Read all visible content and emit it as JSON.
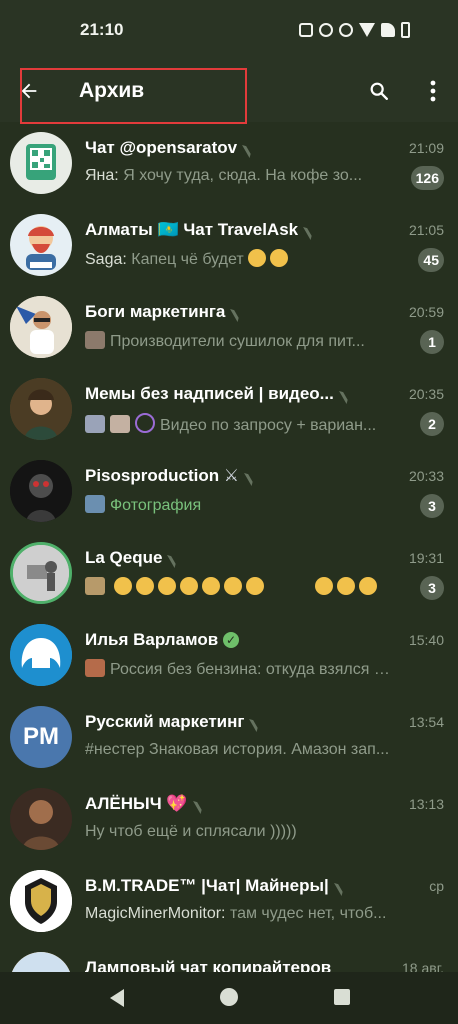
{
  "status": {
    "time": "21:10"
  },
  "header": {
    "title": "Архив"
  },
  "chats": [
    {
      "name": "Чат @opensaratov",
      "time": "21:09",
      "sender": "Яна:",
      "preview": "Я хочу туда, сюда. На кофе зо...",
      "badge": "126"
    },
    {
      "name": "Алматы 🇰🇿 Чат TravelAsk",
      "time": "21:05",
      "sender": "Saga:",
      "preview": "Капец чё будет",
      "badge": "45"
    },
    {
      "name": "Боги маркетинга",
      "time": "20:59",
      "sender": "",
      "preview": "Производители сушилок для пит...",
      "badge": "1"
    },
    {
      "name": "Мемы без надписей | видео...",
      "time": "20:35",
      "sender": "",
      "preview": "Видео по запросу + вариан...",
      "badge": "2"
    },
    {
      "name": "Pisosproduction",
      "time": "20:33",
      "sender": "",
      "preview": "Фотография",
      "badge": "3"
    },
    {
      "name": "La Qeque",
      "time": "19:31",
      "sender": "",
      "preview": "",
      "badge": "3"
    },
    {
      "name": "Илья Варламов",
      "time": "15:40",
      "sender": "",
      "preview": "Россия без бензина: откуда взялся н...",
      "badge": ""
    },
    {
      "name": "Русский маркетинг",
      "time": "13:54",
      "sender": "",
      "preview": "#нестер Знаковая история. Амазон зап...",
      "badge": ""
    },
    {
      "name": "АЛЁНЫЧ",
      "time": "13:13",
      "sender": "",
      "preview": "Ну чтоб ещё и сплясали )))))",
      "badge": ""
    },
    {
      "name": "B.M.TRADE™ |Чат| Майнеры|",
      "time": "ср",
      "sender": "MagicMinerMonitor:",
      "preview": "там чудес нет, чтоб...",
      "badge": ""
    },
    {
      "name": "Ламповый чат копирайтеров",
      "time": "18 авг.",
      "sender": "",
      "preview": "",
      "badge": ""
    }
  ],
  "avatars": {
    "rm_text": "PM"
  },
  "icons": [
    "back-arrow-icon",
    "search-icon",
    "more-vert-icon",
    "mute-icon",
    "verified-icon"
  ],
  "colors": {
    "background": "#26301f",
    "badge": "#596454",
    "accent_green": "#79c17c",
    "highlight": "#e23b3b"
  }
}
